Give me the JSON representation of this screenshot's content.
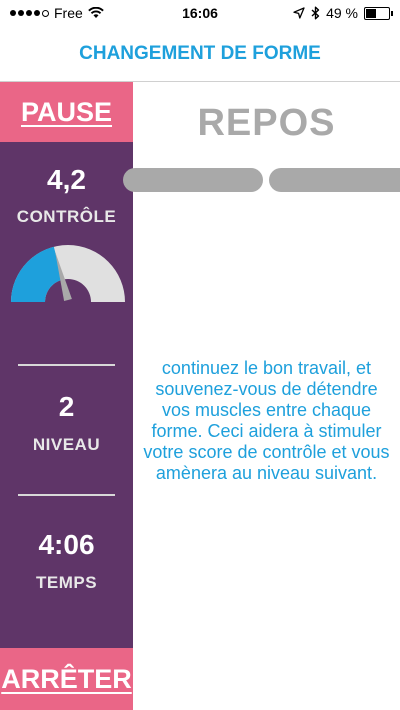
{
  "status_bar": {
    "carrier": "Free",
    "time": "16:06",
    "battery_text": "49 %",
    "battery_level": 0.49,
    "signal_bars_filled": 4,
    "icons": [
      "signal-dots-icon",
      "wifi-icon",
      "location-arrow-icon",
      "bluetooth-icon",
      "battery-icon"
    ]
  },
  "header": {
    "title": "CHANGEMENT DE FORME"
  },
  "sidebar": {
    "pause_label": "PAUSE",
    "stop_label": "ARRÊTER",
    "control": {
      "value": "4,2",
      "label": "CONTRÔLE",
      "gauge_fraction": 0.42
    },
    "level": {
      "value": "2",
      "label": "NIVEAU"
    },
    "time": {
      "value": "4:06",
      "label": "TEMPS"
    }
  },
  "main": {
    "state_label": "REPOS",
    "message": "continuez le bon travail, et souvenez-vous de détendre vos muscles entre chaque forme. Ceci aidera à stimuler votre score de contrôle et vous amènera au niveau suivant."
  },
  "colors": {
    "accent_blue": "#1ea0dc",
    "sidebar_purple": "#5f3568",
    "button_pink": "#ea6687",
    "gray": "#a9a9a9",
    "gauge_track": "#e0e0e0"
  }
}
